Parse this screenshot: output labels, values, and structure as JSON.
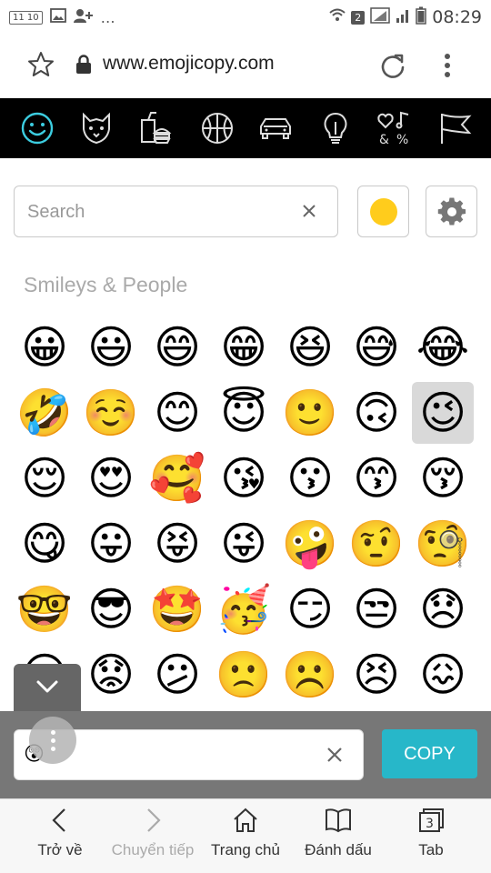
{
  "statusbar": {
    "time": "08:29",
    "sim_badge": "2",
    "left_box": "11 10"
  },
  "urlbar": {
    "url": "www.emojicopy.com"
  },
  "categories": [
    {
      "name": "smileys-icon",
      "active": true
    },
    {
      "name": "animals-icon",
      "active": false
    },
    {
      "name": "food-icon",
      "active": false
    },
    {
      "name": "activity-icon",
      "active": false
    },
    {
      "name": "travel-icon",
      "active": false
    },
    {
      "name": "objects-icon",
      "active": false
    },
    {
      "name": "symbols-icon",
      "active": false
    },
    {
      "name": "flags-icon",
      "active": false
    }
  ],
  "search": {
    "placeholder": "Search"
  },
  "section_title": "Smileys & People",
  "emojis": [
    [
      "😀",
      "😃",
      "😄",
      "😁",
      "😆",
      "😅",
      "😂"
    ],
    [
      "🤣",
      "☺️",
      "😊",
      "😇",
      "🙂",
      "🙃",
      "😉"
    ],
    [
      "😌",
      "😍",
      "🥰",
      "😘",
      "😗",
      "😙",
      "😚"
    ],
    [
      "😋",
      "😛",
      "😝",
      "😜",
      "🤪",
      "🤨",
      "🧐"
    ],
    [
      "🤓",
      "😎",
      "🤩",
      "🥳",
      "😏",
      "😒",
      "😞"
    ],
    [
      "😔",
      "😟",
      "😕",
      "🙁",
      "☹️",
      "😣",
      "😖"
    ]
  ],
  "selected_emoji": "😉",
  "copy": {
    "value": "😲",
    "button_label": "COPY"
  },
  "bottom_nav": [
    {
      "label": "Trở về",
      "icon": "back-icon",
      "enabled": true
    },
    {
      "label": "Chuyển tiếp",
      "icon": "forward-icon",
      "enabled": false
    },
    {
      "label": "Trang chủ",
      "icon": "home-icon",
      "enabled": true
    },
    {
      "label": "Đánh dấu",
      "icon": "bookmarks-icon",
      "enabled": true
    },
    {
      "label": "Tab",
      "icon": "tabs-icon",
      "enabled": true,
      "badge": "3"
    }
  ],
  "colors": {
    "accent": "#27b7c9",
    "category_bar": "#000000",
    "active_category": "#3ccde0",
    "skin_tone": "#ffcc1c"
  }
}
